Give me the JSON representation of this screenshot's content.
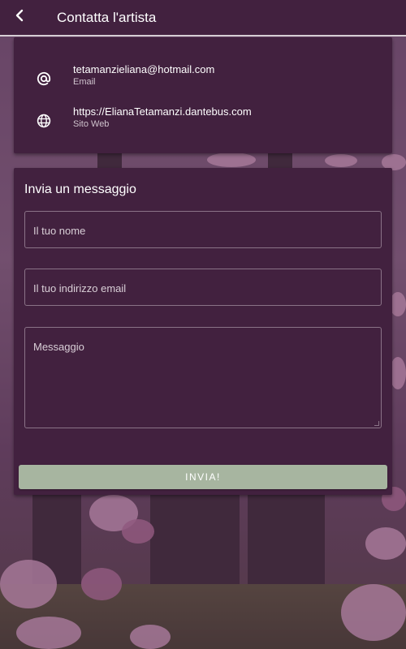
{
  "app_bar": {
    "title": "Contatta l'artista",
    "back_icon": "chevron-left-icon"
  },
  "contact": {
    "items": [
      {
        "icon": "at-sign-icon",
        "value": "tetamanzieliana@hotmail.com",
        "label": "Email"
      },
      {
        "icon": "globe-icon",
        "value": "https://ElianaTetamanzi.dantebus.com",
        "label": "Sito Web"
      }
    ]
  },
  "message_form": {
    "title": "Invia un messaggio",
    "name_placeholder": "Il tuo nome",
    "email_placeholder": "Il tuo indirizzo email",
    "message_placeholder": "Messaggio",
    "send_label": "INVIA!"
  },
  "colors": {
    "primary": "#42213f",
    "button": "#a7b5a0",
    "text": "#ffffff"
  }
}
